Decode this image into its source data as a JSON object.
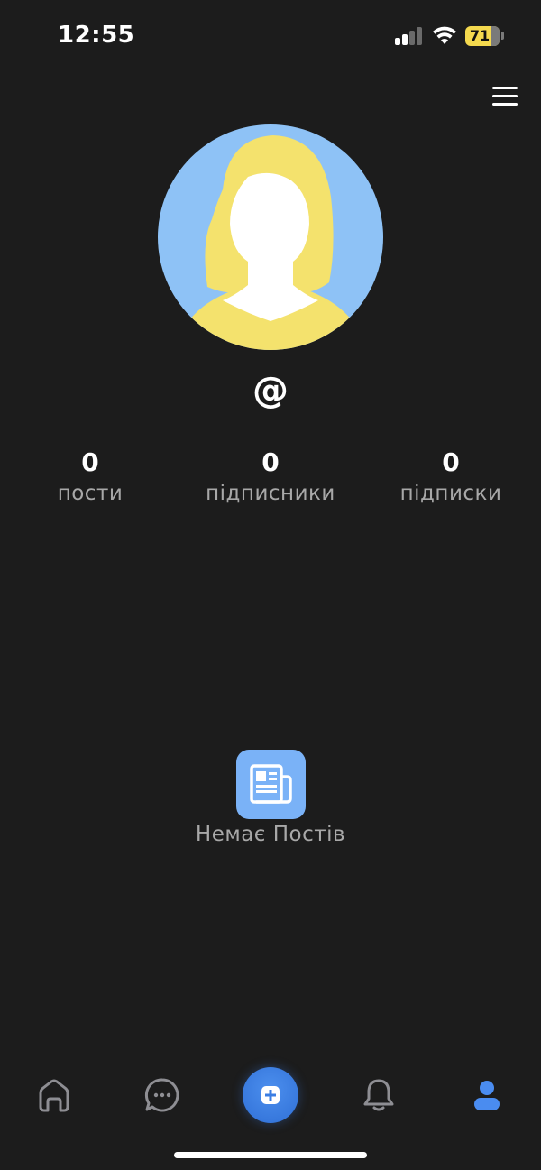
{
  "status_bar": {
    "time": "12:55",
    "battery_level": "71",
    "signal_strength_bars": 2,
    "signal_max_bars": 4
  },
  "header": {
    "menu_icon": "hamburger-menu-icon"
  },
  "profile": {
    "username": "@",
    "avatar_icon": "default-female-avatar",
    "avatar_colors": {
      "background": "#8ec2f6",
      "hair": "#f4e26d",
      "face": "#ffffff"
    }
  },
  "stats": [
    {
      "value": "0",
      "label": "пости"
    },
    {
      "value": "0",
      "label": "підписники"
    },
    {
      "value": "0",
      "label": "підписки"
    }
  ],
  "empty_state": {
    "icon": "newspaper-icon",
    "label": "Немає Постів"
  },
  "tab_bar": {
    "tabs": [
      {
        "icon": "home-icon",
        "active": false
      },
      {
        "icon": "chat-icon",
        "active": false
      },
      {
        "icon": "add-post-icon",
        "active": false
      },
      {
        "icon": "bell-icon",
        "active": false
      },
      {
        "icon": "profile-icon",
        "active": true
      }
    ],
    "active_color": "#4a8cf0",
    "inactive_color": "#8e8e93"
  }
}
